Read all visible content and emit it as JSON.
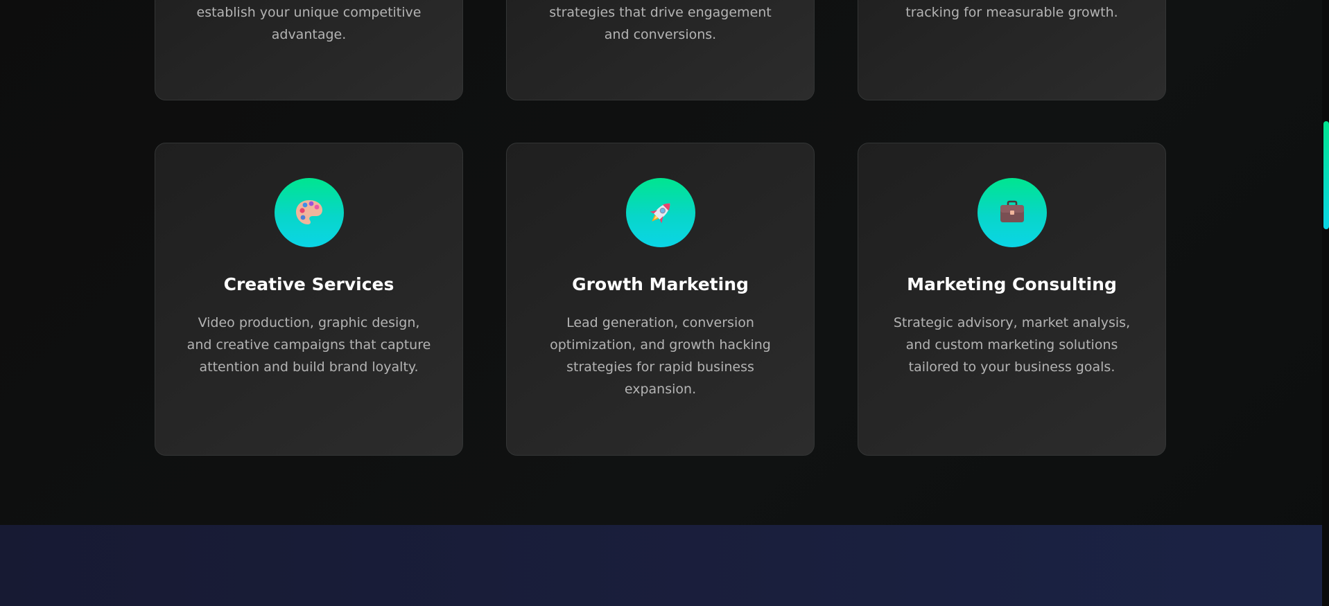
{
  "services": {
    "top_row": [
      {
        "description": "establish your unique competitive advantage."
      },
      {
        "description": "strategies that drive engagement and conversions."
      },
      {
        "description": "tracking for measurable growth."
      }
    ],
    "cards": [
      {
        "icon": "palette-icon",
        "title": "Creative Services",
        "description": "Video production, graphic design, and creative campaigns that capture attention and build brand loyalty."
      },
      {
        "icon": "rocket-icon",
        "title": "Growth Marketing",
        "description": "Lead generation, conversion optimization, and growth hacking strategies for rapid business expansion."
      },
      {
        "icon": "briefcase-icon",
        "title": "Marketing Consulting",
        "description": "Strategic advisory, market analysis, and custom marketing solutions tailored to your business goals."
      }
    ]
  },
  "colors": {
    "accent_start": "#00e58f",
    "accent_end": "#0bd5e6",
    "background": "#0a0a0a",
    "card": "#262626",
    "footer": "#1a1f3d"
  }
}
